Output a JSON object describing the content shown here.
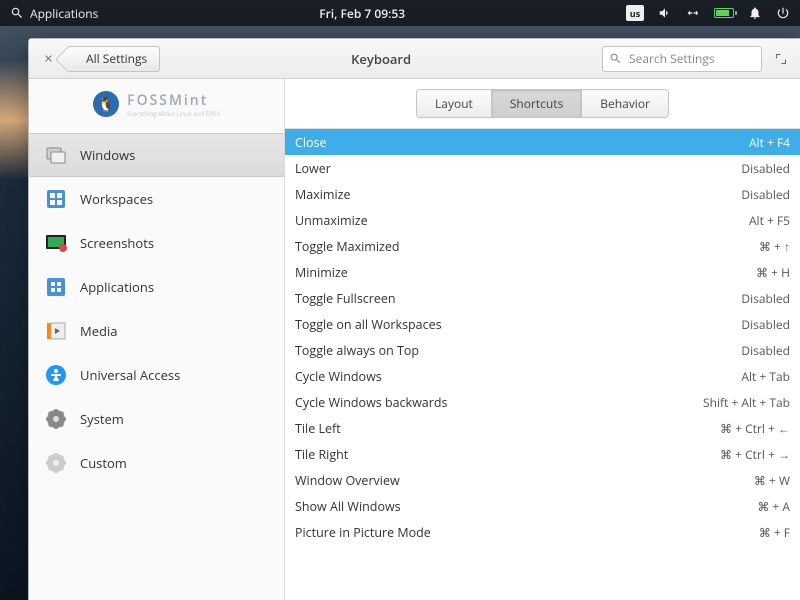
{
  "panel": {
    "app_menu": "Applications",
    "datetime": "Fri, Feb 7   09:53",
    "kb_layout": "us"
  },
  "window": {
    "back_label": "All Settings",
    "title": "Keyboard",
    "search_placeholder": "Search Settings"
  },
  "logo": {
    "text": "FOSSMint",
    "sub": "Everything About Linux and FOSS"
  },
  "sidebar": {
    "items": [
      {
        "label": "Windows"
      },
      {
        "label": "Workspaces"
      },
      {
        "label": "Screenshots"
      },
      {
        "label": "Applications"
      },
      {
        "label": "Media"
      },
      {
        "label": "Universal Access"
      },
      {
        "label": "System"
      },
      {
        "label": "Custom"
      }
    ],
    "selected": 0
  },
  "tabs": {
    "items": [
      "Layout",
      "Shortcuts",
      "Behavior"
    ],
    "active": 1
  },
  "shortcuts": {
    "selected": 0,
    "rows": [
      {
        "name": "Close",
        "value": "Alt + F4"
      },
      {
        "name": "Lower",
        "value": "Disabled"
      },
      {
        "name": "Maximize",
        "value": "Disabled"
      },
      {
        "name": "Unmaximize",
        "value": "Alt + F5"
      },
      {
        "name": "Toggle Maximized",
        "value": "⌘ + ↑"
      },
      {
        "name": "Minimize",
        "value": "⌘ + H"
      },
      {
        "name": "Toggle Fullscreen",
        "value": "Disabled"
      },
      {
        "name": "Toggle on all Workspaces",
        "value": "Disabled"
      },
      {
        "name": "Toggle always on Top",
        "value": "Disabled"
      },
      {
        "name": "Cycle Windows",
        "value": "Alt + Tab"
      },
      {
        "name": "Cycle Windows backwards",
        "value": "Shift + Alt + Tab"
      },
      {
        "name": "Tile Left",
        "value": "⌘ + Ctrl + ←"
      },
      {
        "name": "Tile Right",
        "value": "⌘ + Ctrl + →"
      },
      {
        "name": "Window Overview",
        "value": "⌘ + W"
      },
      {
        "name": "Show All Windows",
        "value": "⌘ + A"
      },
      {
        "name": "Picture in Picture Mode",
        "value": "⌘ + F"
      }
    ]
  }
}
